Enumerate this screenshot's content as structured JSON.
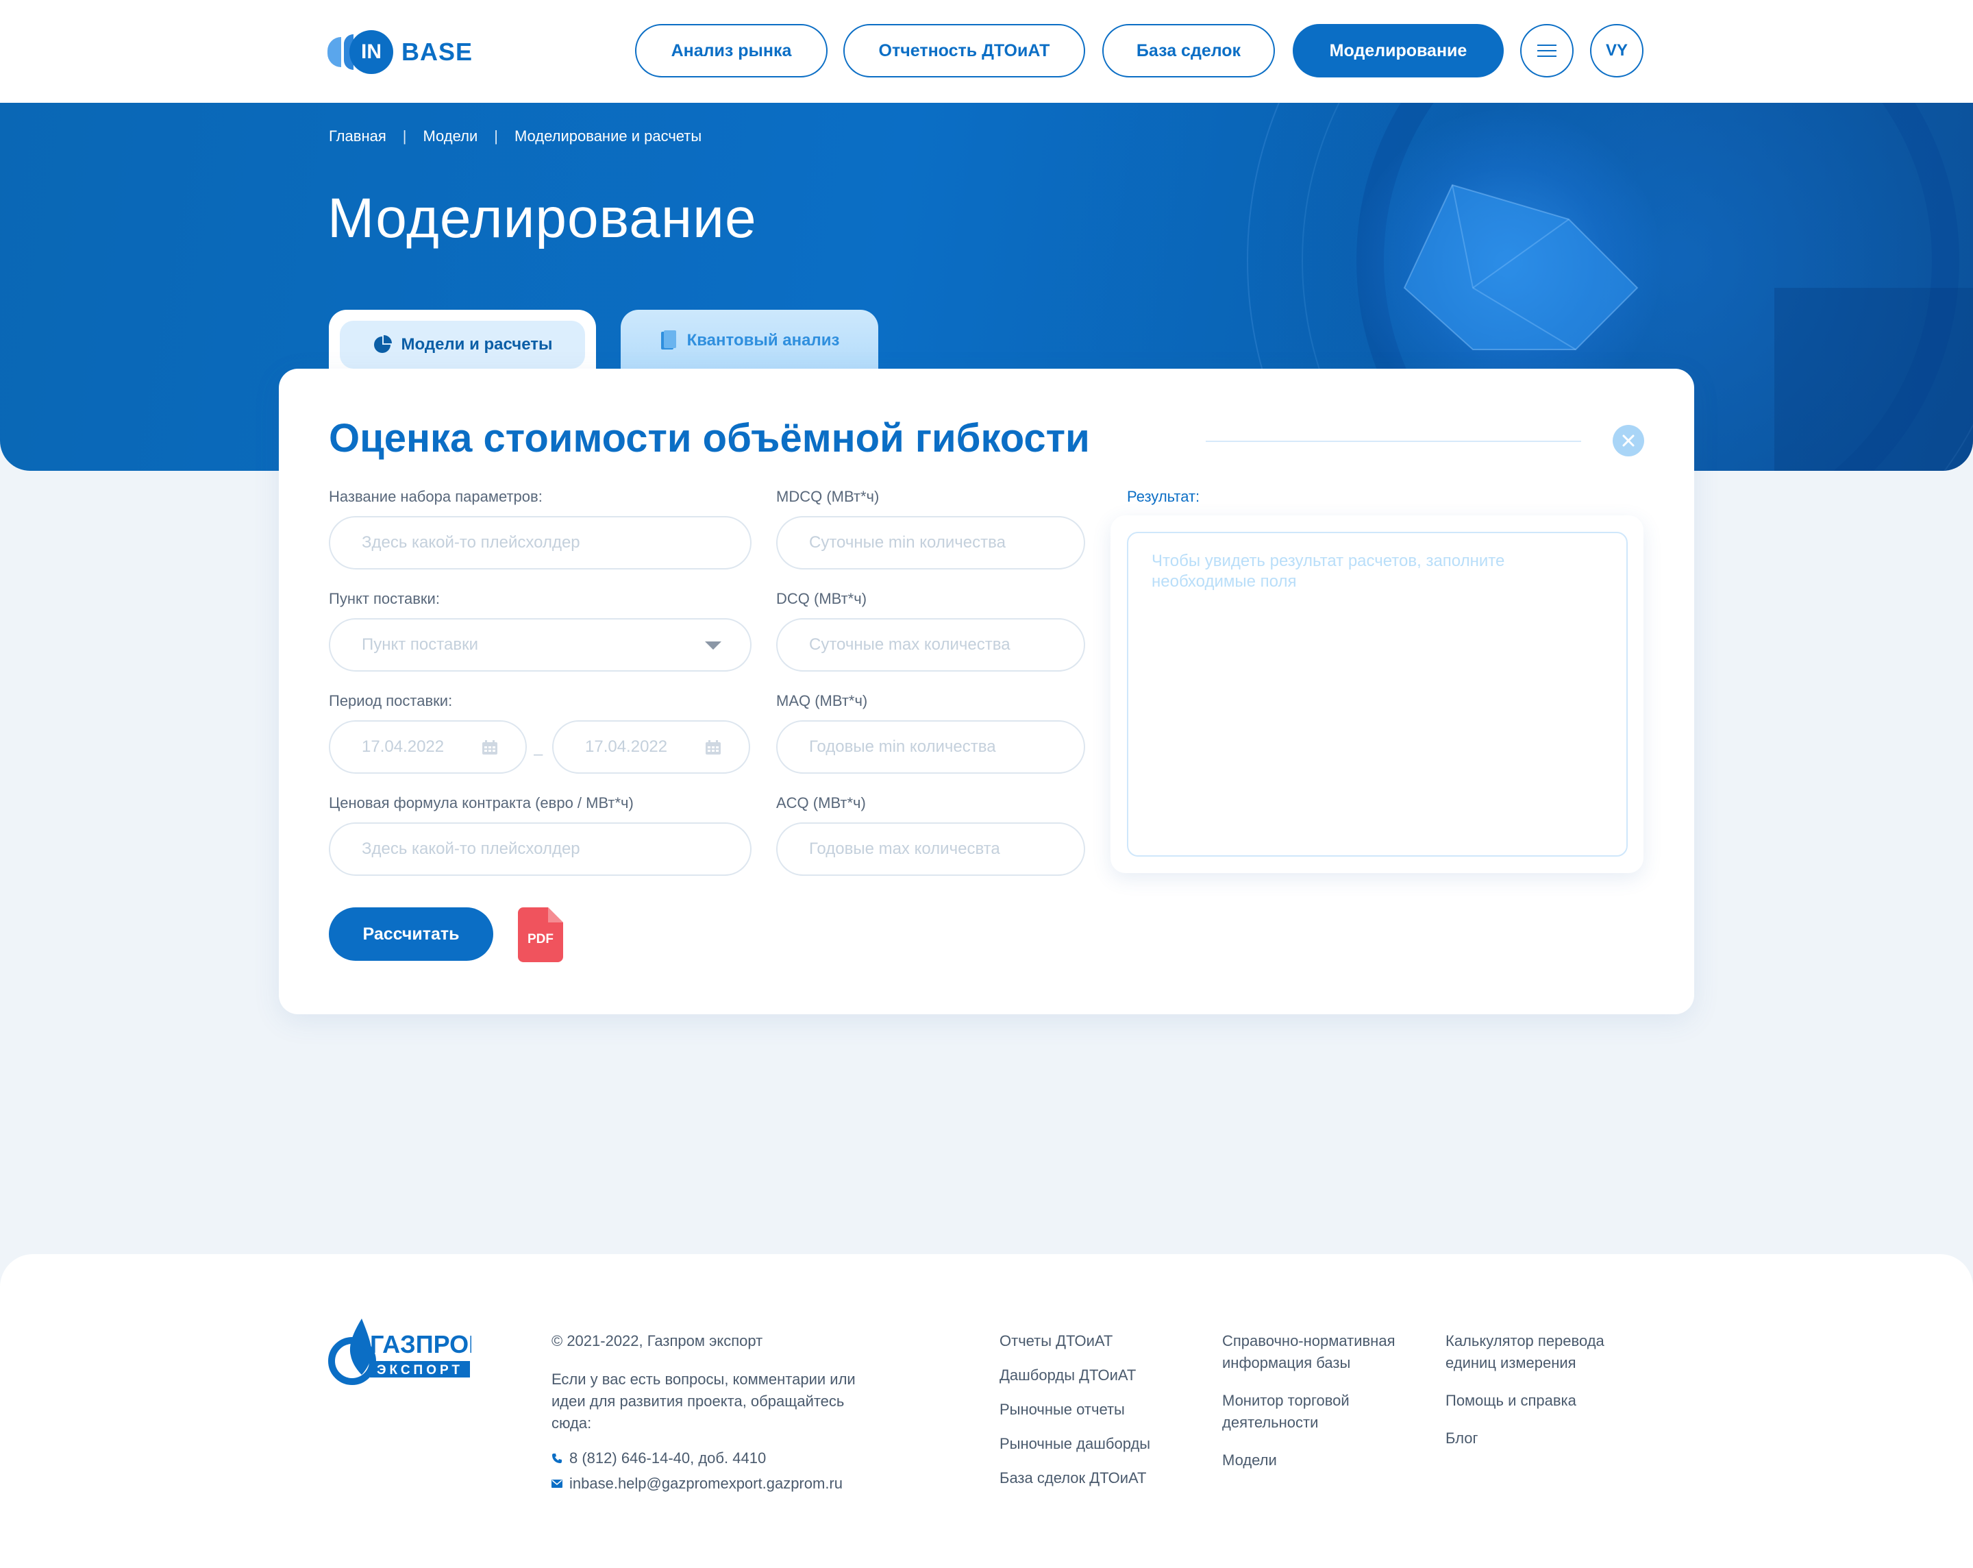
{
  "header": {
    "logo_text": "IN BASE",
    "nav": [
      {
        "label": "Анализ рынка"
      },
      {
        "label": "Отчетность ДТОиАТ"
      },
      {
        "label": "База сделок"
      },
      {
        "label": "Моделирование",
        "active": true
      }
    ],
    "user_initials": "VY"
  },
  "breadcrumb": [
    "Главная",
    "Модели",
    "Моделирование и расчеты"
  ],
  "page_title": "Моделирование",
  "tabs": [
    {
      "label": "Модели и расчеты",
      "icon": "pie-chart-icon",
      "active": true
    },
    {
      "label": "Квантовый анализ",
      "icon": "book-icon",
      "active": false
    }
  ],
  "form": {
    "title": "Оценка стоимости объёмной гибкости",
    "param_set": {
      "label": "Название набора параметров:",
      "placeholder": "Здесь какой-то плейсхолдер"
    },
    "delivery_point": {
      "label": "Пункт поставки:",
      "placeholder": "Пункт поставки"
    },
    "delivery_period": {
      "label": "Период поставки:",
      "from": "17.04.2022",
      "separator": "–",
      "to": "17.04.2022"
    },
    "price_formula": {
      "label": "Ценовая формула контракта (евро / МВт*ч)",
      "placeholder": "Здесь какой-то плейсхолдер"
    },
    "mdcq": {
      "label": "MDCQ (МВт*ч)",
      "placeholder": "Суточные min количества"
    },
    "dcq": {
      "label": "DCQ (МВт*ч)",
      "placeholder": "Суточные max количества"
    },
    "maq": {
      "label": "MAQ (МВт*ч)",
      "placeholder": "Годовые min количества"
    },
    "acq": {
      "label": "ACQ (МВт*ч)",
      "placeholder": "Годовые max количесвта"
    },
    "result": {
      "label": "Результат:",
      "placeholder": "Чтобы увидеть результат расчетов, заполните необходимые поля"
    },
    "calculate_label": "Рассчитать",
    "pdf_label": "PDF"
  },
  "footer": {
    "logo_top": "ГАЗПРОМ",
    "logo_bottom": "ЭКСПОРТ",
    "copyright": "© 2021-2022, Газпром экспорт",
    "contact_text": "Если у вас есть вопросы, комментарии или идеи для развития проекта, обращайтесь сюда:",
    "phone": "8 (812) 646-14-40, доб. 4410",
    "email": "inbase.help@gazpromexport.gazprom.ru",
    "col1": [
      "Отчеты ДТОиАТ",
      "Дашборды ДТОиАТ",
      "Рыночные отчеты",
      "Рыночные дашборды",
      "База сделок ДТОиАТ"
    ],
    "col2": [
      "Справочно-нормативная информация базы",
      "Монитор торговой деятельности",
      "Модели"
    ],
    "col3": [
      "Калькулятор перевода единиц измерения",
      "Помощь и справка",
      "Блог"
    ]
  },
  "colors": {
    "accent": "#0b6ec5",
    "pdf": "#f0535d",
    "background": "#eff4f9"
  }
}
